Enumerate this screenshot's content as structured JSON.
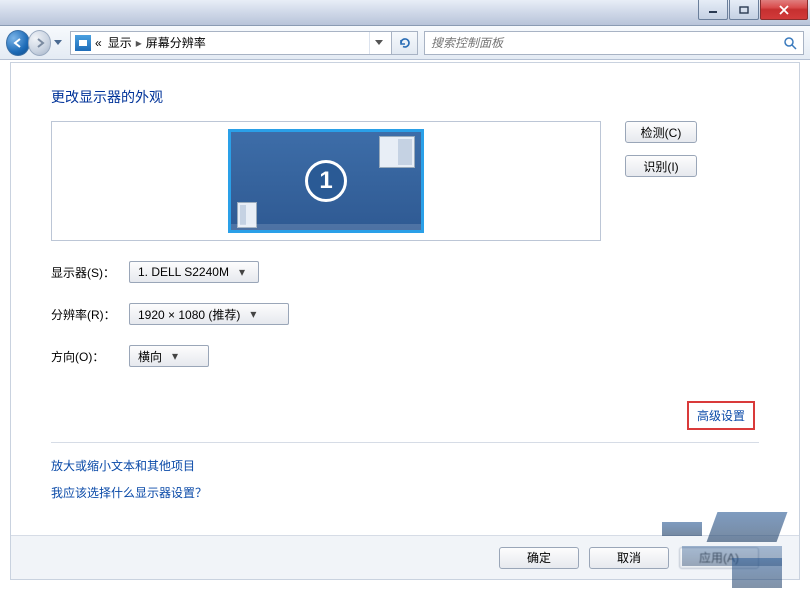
{
  "breadcrumb": {
    "prefix": "«",
    "item1": "显示",
    "item2": "屏幕分辨率"
  },
  "search": {
    "placeholder": "搜索控制面板"
  },
  "heading": "更改显示器的外观",
  "monitor_number": "1",
  "buttons": {
    "detect": "检测(C)",
    "identify": "识别(I)",
    "ok": "确定",
    "cancel": "取消",
    "apply": "应用(A)"
  },
  "labels": {
    "display": "显示器(S)：",
    "resolution": "分辨率(R)：",
    "orientation": "方向(O)："
  },
  "values": {
    "display": "1. DELL S2240M",
    "resolution": "1920 × 1080 (推荐)",
    "orientation": "横向"
  },
  "links": {
    "advanced": "高级设置",
    "scaling": "放大或缩小文本和其他项目",
    "which": "我应该选择什么显示器设置？"
  }
}
